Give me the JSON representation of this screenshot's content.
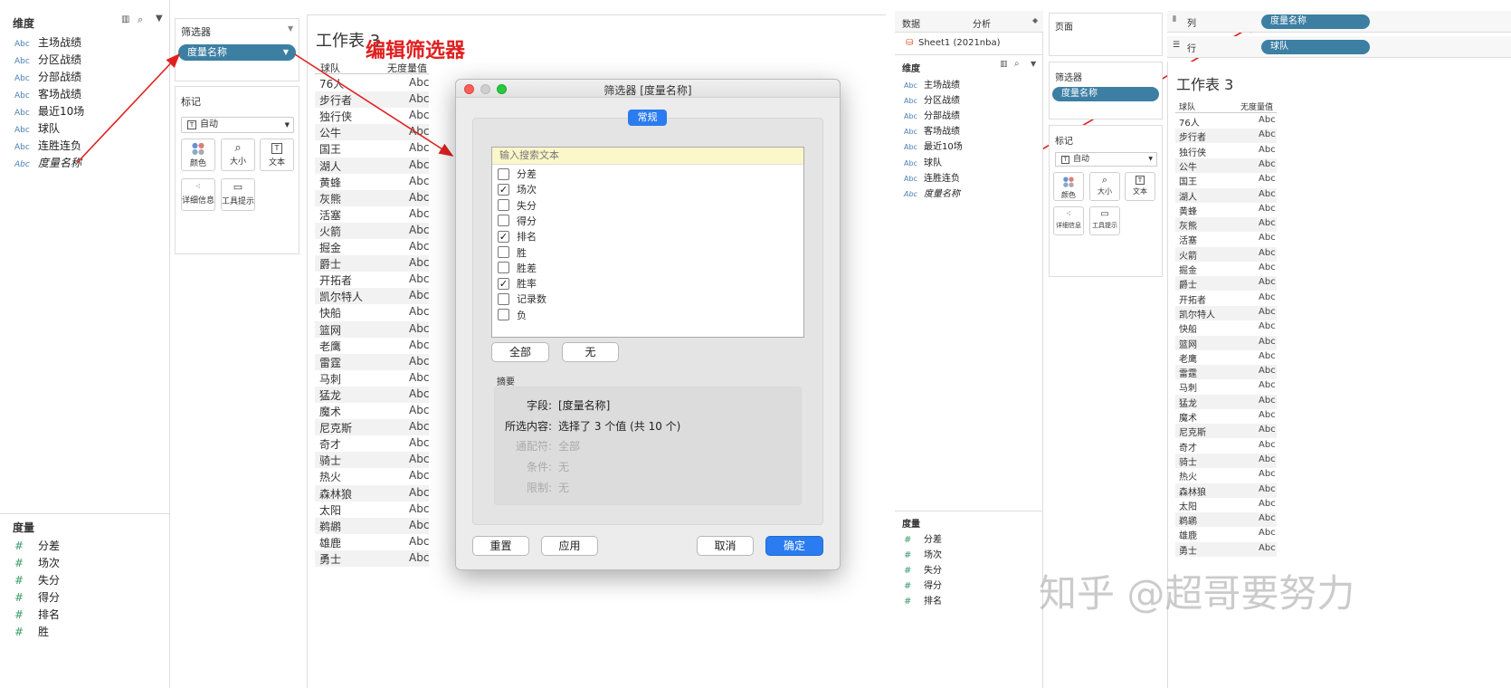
{
  "left_pane": {
    "dimensions_title": "维度",
    "dimensions": [
      "主场战绩",
      "分区战绩",
      "分部战绩",
      "客场战绩",
      "最近10场",
      "球队",
      "连胜连负",
      "度量名称"
    ],
    "measures_title": "度量",
    "measures": [
      "分差",
      "场次",
      "失分",
      "得分",
      "排名",
      "胜"
    ],
    "abc": "Abc",
    "hash": "#"
  },
  "filters_shelf": {
    "title": "筛选器",
    "pill": "度量名称"
  },
  "marks_shelf": {
    "title": "标记",
    "mark_type": "自动",
    "buttons": [
      "颜色",
      "大小",
      "文本",
      "详细信息",
      "工具提示"
    ]
  },
  "annotation": "编辑筛选器",
  "worksheet": {
    "title": "工作表 3",
    "col_team": "球队",
    "col_value": "无度量值",
    "teams": [
      "76人",
      "步行者",
      "独行侠",
      "公牛",
      "国王",
      "湖人",
      "黄蜂",
      "灰熊",
      "活塞",
      "火箭",
      "掘金",
      "爵士",
      "开拓者",
      "凯尔特人",
      "快船",
      "篮网",
      "老鹰",
      "雷霆",
      "马刺",
      "猛龙",
      "魔术",
      "尼克斯",
      "奇才",
      "骑士",
      "热火",
      "森林狼",
      "太阳",
      "鹈鹕",
      "雄鹿",
      "勇士"
    ],
    "cell_value": "Abc"
  },
  "dialog": {
    "title": "筛选器 [度量名称]",
    "tab": "常规",
    "search_placeholder": "输入搜索文本",
    "items": [
      {
        "label": "分差",
        "checked": false
      },
      {
        "label": "场次",
        "checked": true
      },
      {
        "label": "失分",
        "checked": false
      },
      {
        "label": "得分",
        "checked": false
      },
      {
        "label": "排名",
        "checked": true
      },
      {
        "label": "胜",
        "checked": false
      },
      {
        "label": "胜差",
        "checked": false
      },
      {
        "label": "胜率",
        "checked": true
      },
      {
        "label": "记录数",
        "checked": false
      },
      {
        "label": "负",
        "checked": false
      }
    ],
    "all_button": "全部",
    "none_button": "无",
    "summary_title": "摘要",
    "summary": [
      {
        "label": "字段:",
        "value": "[度量名称]",
        "enabled": true
      },
      {
        "label": "所选内容:",
        "value": "选择了 3 个值 (共 10 个)",
        "enabled": true
      },
      {
        "label": "通配符:",
        "value": "全部",
        "enabled": false
      },
      {
        "label": "条件:",
        "value": "无",
        "enabled": false
      },
      {
        "label": "限制:",
        "value": "无",
        "enabled": false
      }
    ],
    "reset_button": "重置",
    "apply_button": "应用",
    "cancel_button": "取消",
    "ok_button": "确定"
  },
  "right_data_pane": {
    "tab_data": "数据",
    "tab_analysis": "分析",
    "datasource": "Sheet1 (2021nba)",
    "dimensions_title": "维度",
    "dimensions": [
      "主场战绩",
      "分区战绩",
      "分部战绩",
      "客场战绩",
      "最近10场",
      "球队",
      "连胜连负",
      "度量名称"
    ],
    "measures_title": "度量",
    "measures": [
      "分差",
      "场次",
      "失分",
      "得分",
      "排名"
    ]
  },
  "right_shelves": {
    "pages_title": "页面",
    "filters_title": "筛选器",
    "filters_pill": "度量名称",
    "marks_title": "标记",
    "mark_type": "自动",
    "buttons": [
      "颜色",
      "大小",
      "文本",
      "详细信息",
      "工具提示"
    ],
    "columns_label": "列",
    "columns_pill": "度量名称",
    "rows_label": "行",
    "rows_pill": "球队"
  },
  "right_sheet": {
    "title": "工作表 3",
    "col_team": "球队",
    "col_value": "无度量值",
    "teams": [
      "76人",
      "步行者",
      "独行侠",
      "公牛",
      "国王",
      "湖人",
      "黄蜂",
      "灰熊",
      "活塞",
      "火箭",
      "掘金",
      "爵士",
      "开拓者",
      "凯尔特人",
      "快船",
      "篮网",
      "老鹰",
      "雷霆",
      "马刺",
      "猛龙",
      "魔术",
      "尼克斯",
      "奇才",
      "骑士",
      "热火",
      "森林狼",
      "太阳",
      "鹈鹕",
      "雄鹿",
      "勇士"
    ],
    "cell_value": "Abc"
  },
  "watermark": "知乎 @超哥要努力",
  "colors": {
    "pill": "#3c7fa3",
    "arrow": "#e02020",
    "ok": "#2a7cf0",
    "tab": "#2a7cf0"
  }
}
